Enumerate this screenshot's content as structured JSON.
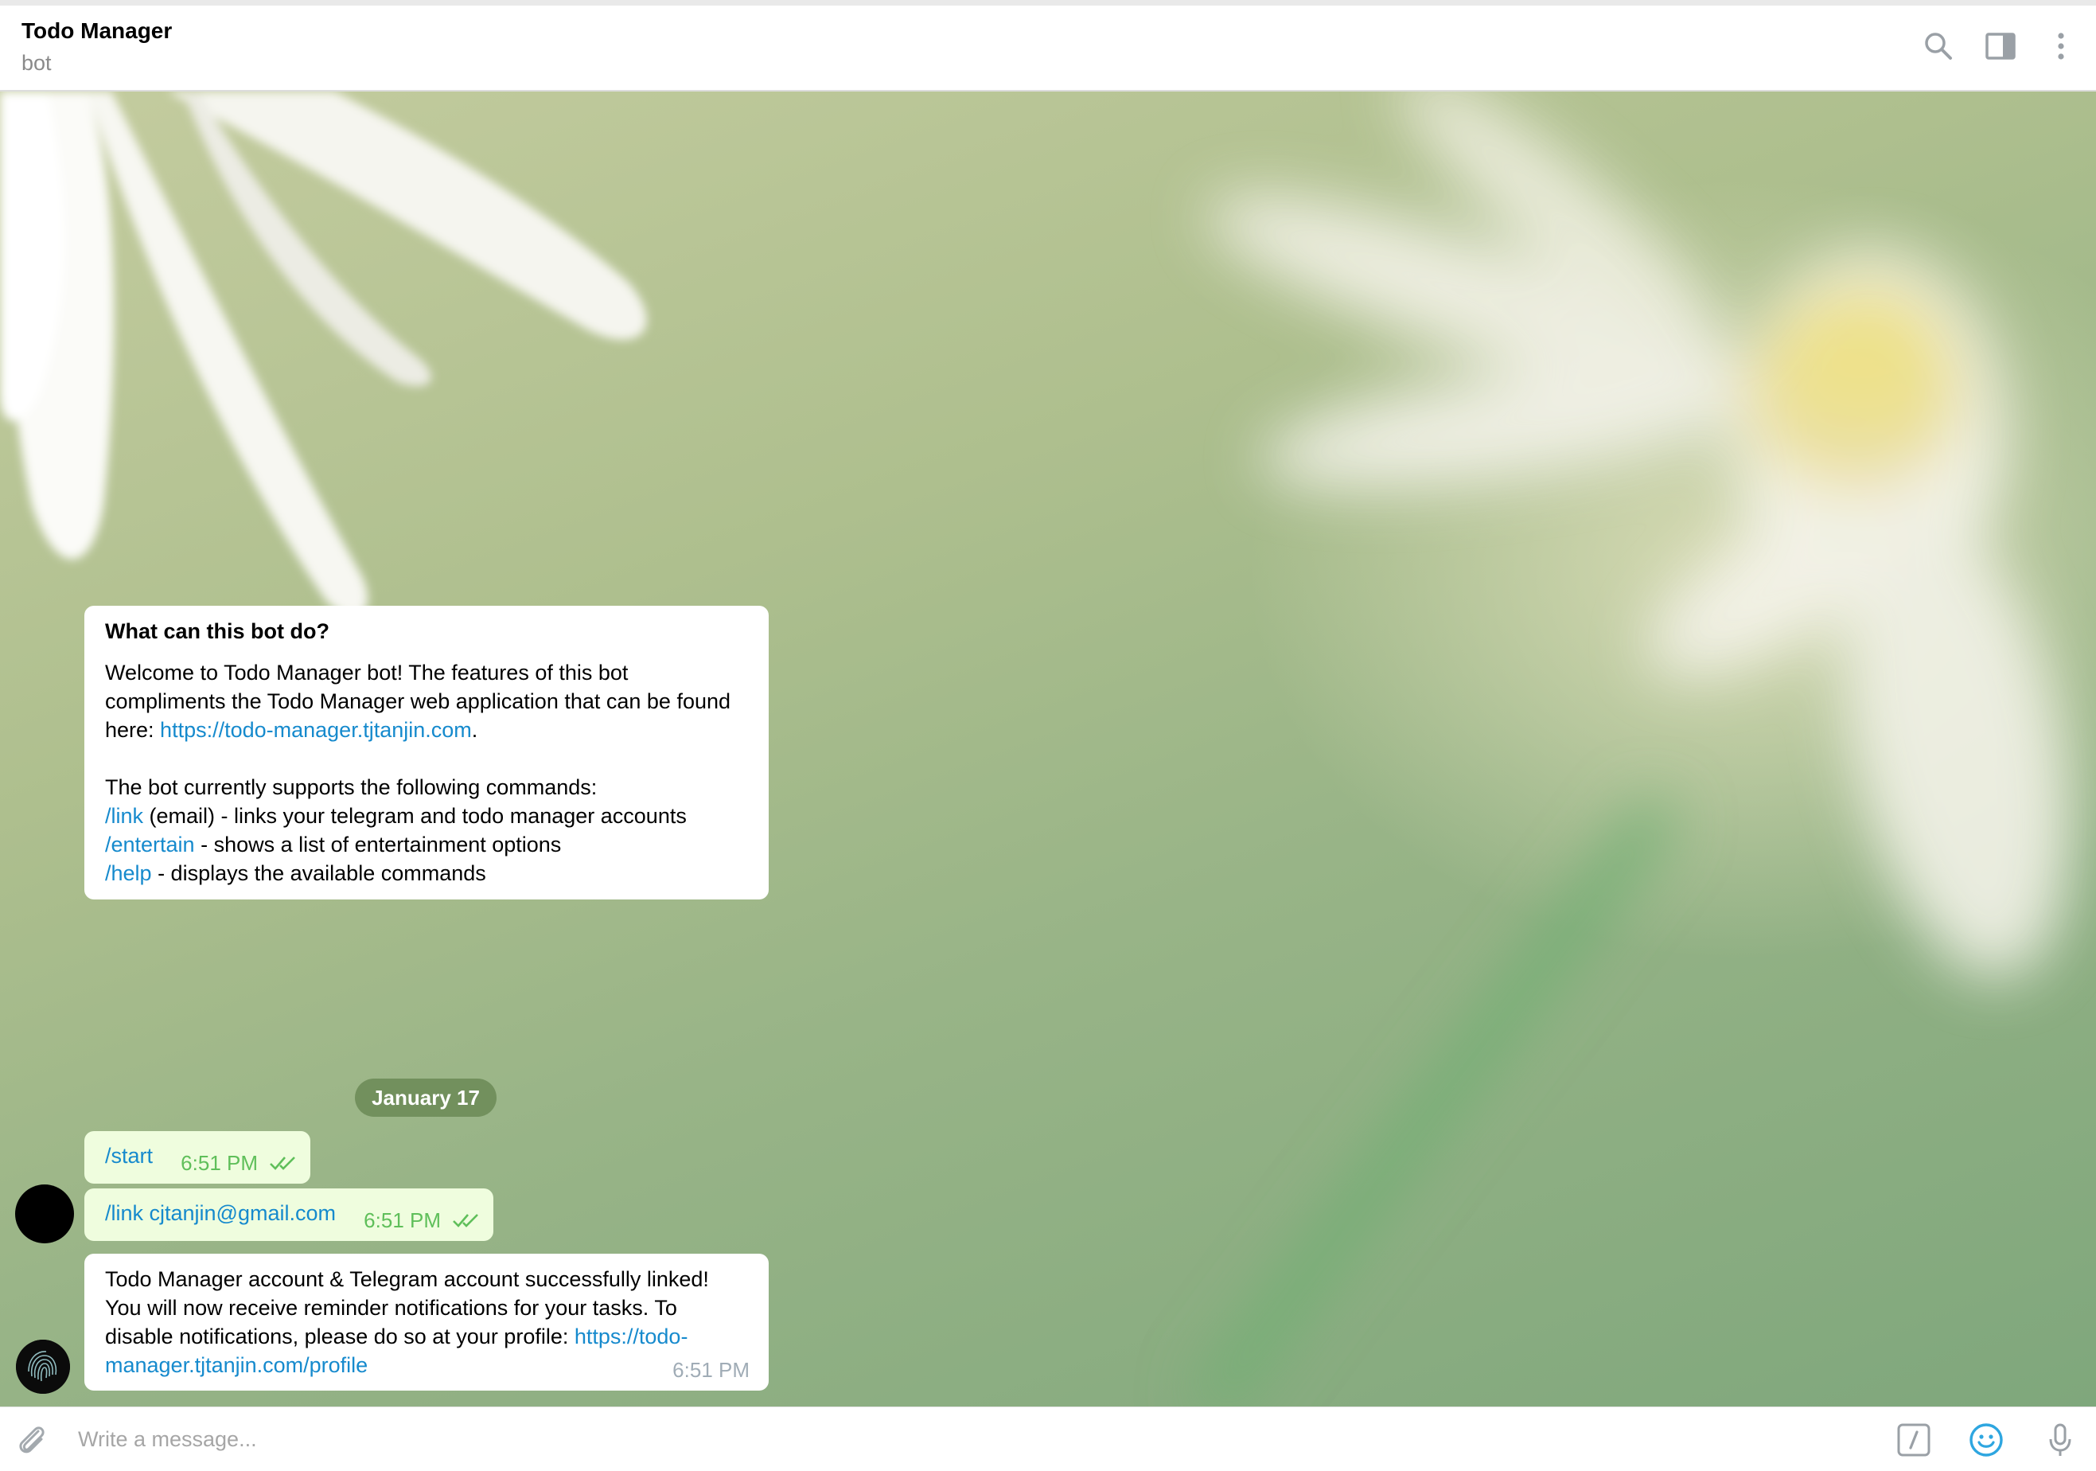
{
  "header": {
    "title": "Todo Manager",
    "subtitle": "bot",
    "icons": [
      "search-icon",
      "sidebar-toggle-icon",
      "more-vert-icon"
    ]
  },
  "bot_info": {
    "title": "What can this bot do?",
    "intro_text": "Welcome to Todo Manager bot! The features of this bot compliments the Todo Manager web application that can be found here: ",
    "intro_link": "https://todo-manager.tjtanjin.com",
    "intro_end": ".",
    "commands_intro": "The bot currently supports the following commands:",
    "commands": [
      {
        "command": "/link",
        "description": " (email) - links your telegram and todo manager accounts"
      },
      {
        "command": "/entertain",
        "description": " - shows a list of entertainment options"
      },
      {
        "command": "/help",
        "description": " - displays the available commands"
      }
    ]
  },
  "date_separator": "January 17",
  "messages": [
    {
      "direction": "out",
      "text": "/start",
      "time": "6:51 PM",
      "status": "read"
    },
    {
      "direction": "out",
      "text": "/link cjtanjin@gmail.com",
      "time": "6:51 PM",
      "status": "read"
    },
    {
      "direction": "in",
      "text_before": "Todo Manager account & Telegram account successfully linked! You will now receive reminder notifications for your tasks. To disable notifications, please do so at your profile: ",
      "link": "https://todo-manager.tjtanjin.com/profile",
      "time": "6:51 PM"
    }
  ],
  "composer": {
    "placeholder": "Write a message...",
    "value": "",
    "icons": [
      "attach-icon",
      "bot-command-icon",
      "emoji-icon",
      "microphone-icon"
    ]
  },
  "colors": {
    "link": "#168acd",
    "outgoing_bubble": "#effdde",
    "outgoing_time": "#5fbf5a",
    "incoming_time": "#a0acb6",
    "date_pill": "#6b8a56",
    "accent": "#2ea6e0"
  }
}
